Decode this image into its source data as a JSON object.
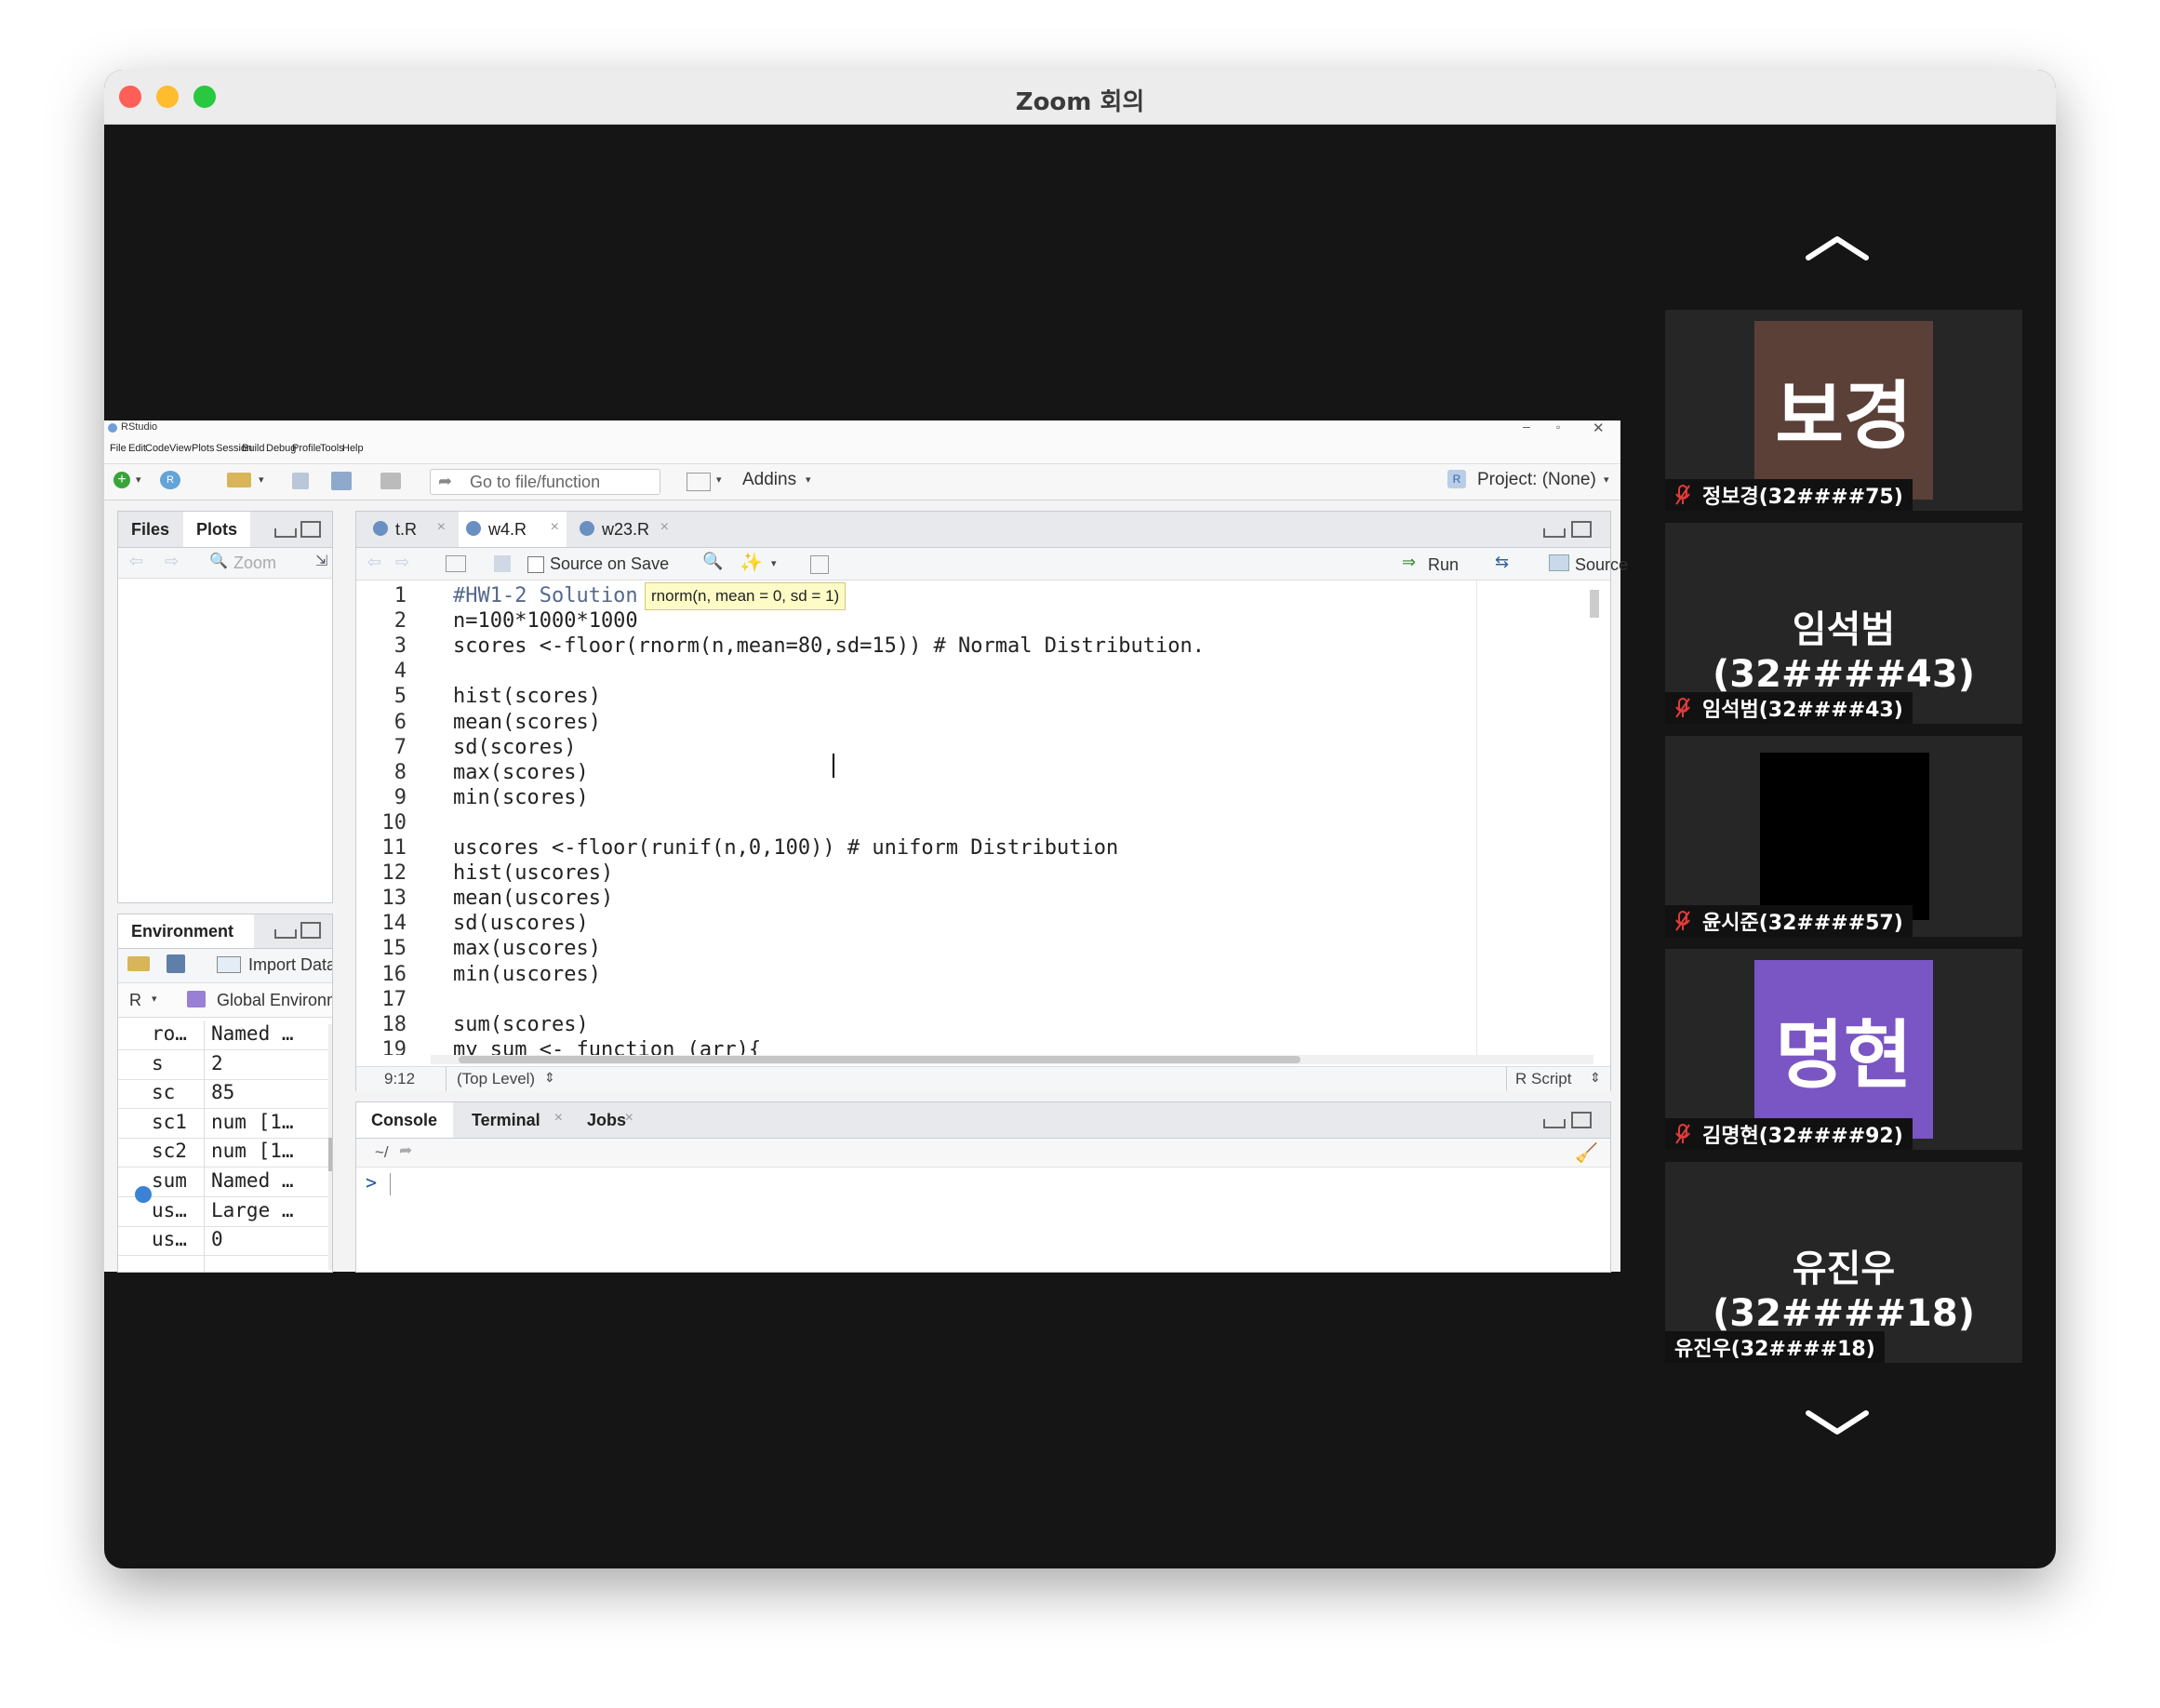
{
  "window": {
    "title": "Zoom 회의"
  },
  "rstudio": {
    "app_title": "RStudio",
    "menu": [
      "File",
      "Edit",
      "Code",
      "View",
      "Plots",
      "Session",
      "Build",
      "Debug",
      "Profile",
      "Tools",
      "Help"
    ],
    "toolbar": {
      "goto_placeholder": "Go to file/function",
      "addins": "Addins",
      "project": "Project: (None)"
    },
    "files_pane": {
      "tabs": [
        "Files",
        "Plots"
      ],
      "zoom": "Zoom"
    },
    "env_pane": {
      "tab": "Environment",
      "import": "Import Data",
      "lang": "R",
      "scope": "Global Environm",
      "rows": [
        {
          "name": "ro…",
          "value": "Named …"
        },
        {
          "name": "s",
          "value": "2"
        },
        {
          "name": "sc",
          "value": "85"
        },
        {
          "name": "sc1",
          "value": "num [1…"
        },
        {
          "name": "sc2",
          "value": "num [1…"
        },
        {
          "name": "sum",
          "value": "Named …"
        },
        {
          "name": "us…",
          "value": "Large …"
        },
        {
          "name": "us…",
          "value": "0"
        }
      ]
    },
    "editor": {
      "tabs": [
        "t.R",
        "w4.R",
        "w23.R"
      ],
      "source_on_save": "Source on Save",
      "run": "Run",
      "source": "Source",
      "tooltip": "rnorm(n, mean = 0, sd = 1)",
      "lines": [
        "#HW1-2 Solution",
        "n=100*1000*1000",
        "scores <-floor(rnorm(n,mean=80,sd=15)) # Normal Distribution.",
        "",
        "hist(scores)",
        "mean(scores)",
        "sd(scores)",
        "max(scores)",
        "min(scores)",
        "",
        "uscores <-floor(runif(n,0,100)) # uniform Distribution",
        "hist(uscores)",
        "mean(uscores)",
        "sd(uscores)",
        "max(uscores)",
        "min(uscores)",
        "",
        "sum(scores)",
        "my_sum <- function (arr){"
      ],
      "line_numbers": [
        "1",
        "2",
        "3",
        "4",
        "5",
        "6",
        "7",
        "8",
        "9",
        "10",
        "11",
        "12",
        "13",
        "14",
        "15",
        "16",
        "17",
        "18",
        "19"
      ],
      "status_pos": "9:12",
      "status_scope": "(Top Level)",
      "status_type": "R Script"
    },
    "console": {
      "tabs": [
        "Console",
        "Terminal",
        "Jobs"
      ],
      "path": "~/",
      "prompt": ">"
    }
  },
  "participants": [
    {
      "avatar_text": "보경",
      "name": "정보경(32####75)",
      "avatar_color": "#5b4038",
      "muted": true
    },
    {
      "big_name": "임석범(32####43)",
      "name": "임석범(32####43)",
      "muted": true
    },
    {
      "avatar_color": "#000000",
      "name": "윤시준(32####57)",
      "muted": true
    },
    {
      "avatar_text": "명현",
      "name": "김명현(32####92)",
      "avatar_color": "#7a55c4",
      "muted": true
    },
    {
      "big_name": "유진우(32####18)",
      "name": "유진우(32####18)",
      "muted": false
    }
  ]
}
